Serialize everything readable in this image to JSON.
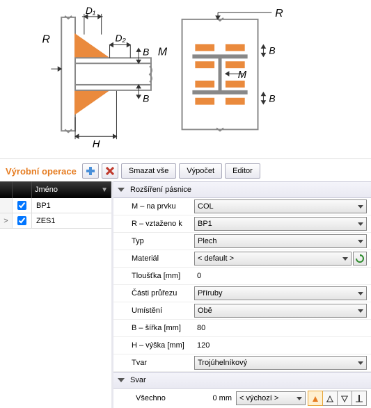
{
  "toolbar": {
    "title": "Výrobní operace",
    "smazat": "Smazat vše",
    "vypocet": "Výpočet",
    "editor": "Editor"
  },
  "grid": {
    "col_name": "Jméno",
    "rows": [
      {
        "name": "BP1",
        "checked": true,
        "sel": false
      },
      {
        "name": "ZES1",
        "checked": true,
        "sel": true
      }
    ]
  },
  "section1": {
    "title": "Rozšíření pásnice",
    "m_label": "M – na prvku",
    "m_val": "COL",
    "r_label": "R – vztaženo k",
    "r_val": "BP1",
    "typ_label": "Typ",
    "typ_val": "Plech",
    "mat_label": "Materiál",
    "mat_val": "< default >",
    "t_label": "Tloušťka [mm]",
    "t_val": "0",
    "cp_label": "Části průřezu",
    "cp_val": "Příruby",
    "um_label": "Umístění",
    "um_val": "Obě",
    "b_label": "B – šířka [mm]",
    "b_val": "80",
    "h_label": "H – výška [mm]",
    "h_val": "120",
    "tv_label": "Tvar",
    "tv_val": "Trojúhelníkový"
  },
  "section2": {
    "title": "Svar",
    "all_label": "Všechno",
    "all_val": "0 mm",
    "dd": "< výchozí >"
  },
  "diagram": {
    "R": "R",
    "D1": "D₁",
    "D2": "D₂",
    "B": "B",
    "M": "M",
    "H": "H"
  }
}
